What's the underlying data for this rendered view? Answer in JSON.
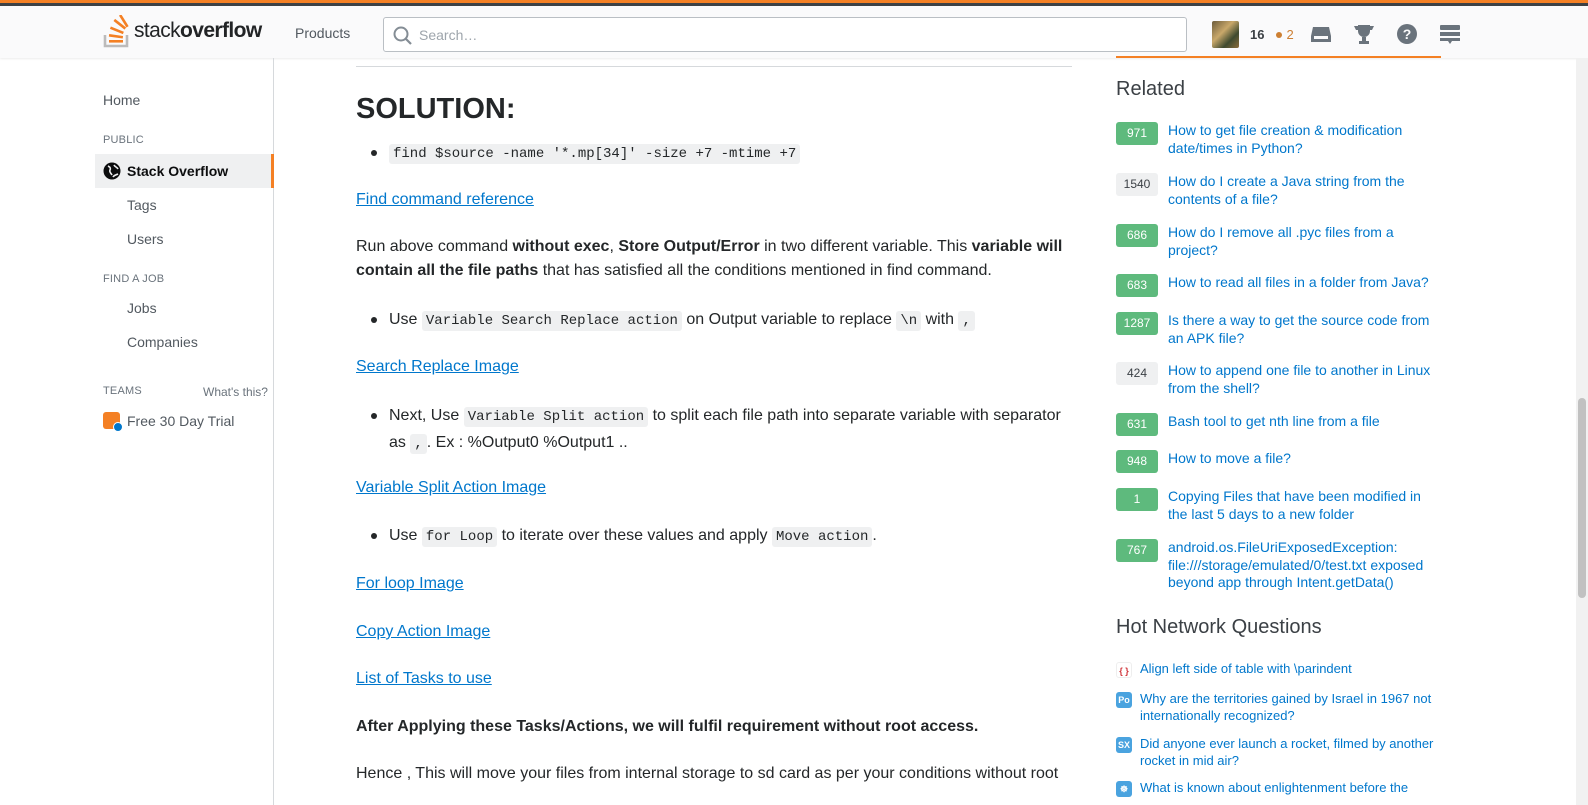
{
  "header": {
    "logo_light": "stack",
    "logo_bold": "overflow",
    "products_label": "Products",
    "search_placeholder": "Search…",
    "reputation": "16",
    "bronze_badges": "2",
    "icons": [
      "inbox-icon",
      "achievements-icon",
      "help-icon",
      "site-switcher-icon"
    ]
  },
  "leftnav": {
    "home": "Home",
    "public_heading": "PUBLIC",
    "active_item": "Stack Overflow",
    "tags": "Tags",
    "users": "Users",
    "find_job_heading": "FIND A JOB",
    "jobs": "Jobs",
    "companies": "Companies",
    "teams_heading": "TEAMS",
    "whats_this": "What's this?",
    "trial": "Free 30 Day Trial"
  },
  "main": {
    "heading": "SOLUTION:",
    "find_cmd": "find $source -name '*.mp[34]' -size +7 -mtime +7",
    "link_find": "Find command reference",
    "p1_a": "Run above command ",
    "p1_b": "without exec",
    "p1_c": ", ",
    "p1_d": "Store Output/Error",
    "p1_e": " in two different variable. This ",
    "p1_f": "variable will contain all the file paths",
    "p1_g": " that has satisfied all the conditions mentioned in find command.",
    "b1_a": "Use ",
    "b1_code": "Variable Search Replace action",
    "b1_b": " on Output variable to replace ",
    "b1_code2": "\\n",
    "b1_c": " with ",
    "b1_code3": ",",
    "link_search": "Search Replace Image",
    "b2_a": "Next, Use ",
    "b2_code": "Variable Split action",
    "b2_b": " to split each file path into separate variable with separator as ",
    "b2_code2": ",",
    "b2_c": ". Ex : %Output0 %Output1 ..",
    "link_split": "Variable Split Action Image",
    "b3_a": "Use ",
    "b3_code": "for Loop",
    "b3_b": " to iterate over these values and apply ",
    "b3_code2": "Move action",
    "b3_c": ".",
    "link_for": "For loop Image",
    "link_copy": "Copy Action Image",
    "link_tasks": "List of Tasks to use",
    "bold_note": "After Applying these Tasks/Actions, we will fulfil requirement without root access.",
    "last_p": "Hence , This will move your files from internal storage to sd card as per your conditions without root"
  },
  "related": {
    "title": "Related",
    "items": [
      {
        "score": "971",
        "accepted": true,
        "title": "How to get file creation & modification date/times in Python?"
      },
      {
        "score": "1540",
        "accepted": false,
        "title": "How do I create a Java string from the contents of a file?"
      },
      {
        "score": "686",
        "accepted": true,
        "title": "How do I remove all .pyc files from a project?"
      },
      {
        "score": "683",
        "accepted": true,
        "title": "How to read all files in a folder from Java?"
      },
      {
        "score": "1287",
        "accepted": true,
        "title": "Is there a way to get the source code from an APK file?"
      },
      {
        "score": "424",
        "accepted": false,
        "title": "How to append one file to another in Linux from the shell?"
      },
      {
        "score": "631",
        "accepted": true,
        "title": "Bash tool to get nth line from a file"
      },
      {
        "score": "948",
        "accepted": true,
        "title": "How to move a file?"
      },
      {
        "score": "1",
        "accepted": true,
        "title": "Copying Files that have been modified in the last 5 days to a new folder"
      },
      {
        "score": "767",
        "accepted": true,
        "title": "android.os.FileUriExposedException: file:///storage/emulated/0/test.txt exposed beyond app through Intent.getData()"
      }
    ]
  },
  "hnq": {
    "title": "Hot Network Questions",
    "items": [
      {
        "site_icon": "tex-icon",
        "color": "#ffffff",
        "title": "Align left side of table with \\parindent"
      },
      {
        "site_icon": "politics-icon",
        "color": "#4aa3df",
        "title": "Why are the territories gained by Israel in 1967 not internationally recognized?"
      },
      {
        "site_icon": "space-icon",
        "color": "#4aa3df",
        "title": "Did anyone ever launch a rocket, filmed by another rocket in mid air?"
      },
      {
        "site_icon": "buddhism-icon",
        "color": "#4aa3df",
        "title": "What is known about enlightenment before the"
      }
    ]
  },
  "colors": {
    "accent": "#f48024",
    "link": "#0077cc",
    "accepted": "#5eba7d"
  }
}
